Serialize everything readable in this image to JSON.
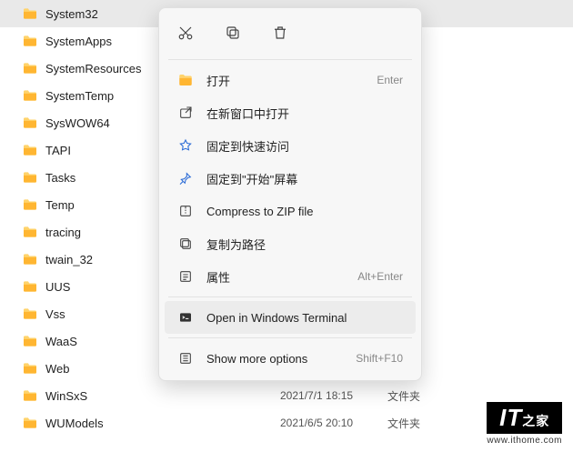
{
  "folders": [
    {
      "name": "System32",
      "date": "",
      "type": "",
      "selected": true
    },
    {
      "name": "SystemApps",
      "date": "",
      "type": ""
    },
    {
      "name": "SystemResources",
      "date": "",
      "type": ""
    },
    {
      "name": "SystemTemp",
      "date": "",
      "type": ""
    },
    {
      "name": "SysWOW64",
      "date": "",
      "type": ""
    },
    {
      "name": "TAPI",
      "date": "",
      "type": ""
    },
    {
      "name": "Tasks",
      "date": "",
      "type": ""
    },
    {
      "name": "Temp",
      "date": "",
      "type": ""
    },
    {
      "name": "tracing",
      "date": "",
      "type": ""
    },
    {
      "name": "twain_32",
      "date": "",
      "type": ""
    },
    {
      "name": "UUS",
      "date": "",
      "type": ""
    },
    {
      "name": "Vss",
      "date": "",
      "type": ""
    },
    {
      "name": "WaaS",
      "date": "",
      "type": ""
    },
    {
      "name": "Web",
      "date": "",
      "type": ""
    },
    {
      "name": "WinSxS",
      "date": "2021/7/1 18:15",
      "type": "文件夹"
    },
    {
      "name": "WUModels",
      "date": "2021/6/5 20:10",
      "type": "文件夹"
    }
  ],
  "menu": {
    "open": {
      "label": "打开",
      "shortcut": "Enter"
    },
    "newWindow": {
      "label": "在新窗口中打开",
      "shortcut": ""
    },
    "pinQuick": {
      "label": "固定到快速访问",
      "shortcut": ""
    },
    "pinStart": {
      "label": "固定到\"开始\"屏幕",
      "shortcut": ""
    },
    "zip": {
      "label": "Compress to ZIP file",
      "shortcut": ""
    },
    "copyPath": {
      "label": "复制为路径",
      "shortcut": ""
    },
    "properties": {
      "label": "属性",
      "shortcut": "Alt+Enter"
    },
    "terminal": {
      "label": "Open in Windows Terminal",
      "shortcut": ""
    },
    "more": {
      "label": "Show more options",
      "shortcut": "Shift+F10"
    }
  },
  "watermark": {
    "logo": "IT",
    "sub": "www.ithome.com"
  }
}
